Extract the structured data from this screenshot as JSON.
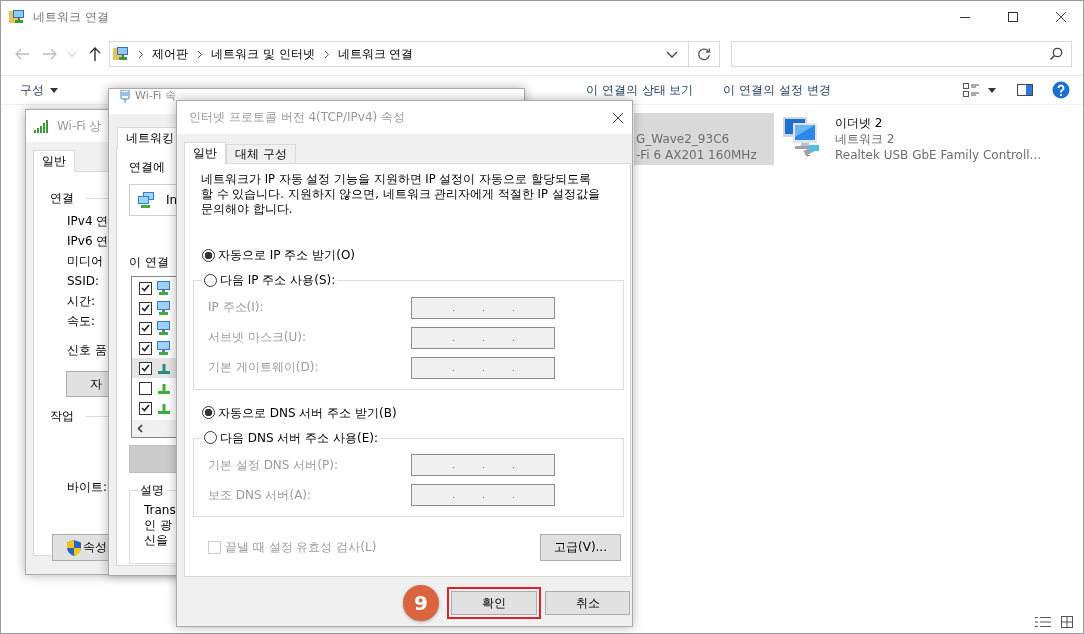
{
  "window": {
    "title": "네트워크 연결"
  },
  "address_bar": {
    "breadcrumbs": [
      "제어판",
      "네트워크 및 인터넷",
      "네트워크 연결"
    ]
  },
  "toolbar": {
    "items": [
      {
        "kind": "menu",
        "label": "구성"
      },
      {
        "kind": "command",
        "label": "이 연결의 상태 보기"
      },
      {
        "kind": "command",
        "label": "이 연결의 설정 변경"
      }
    ]
  },
  "connections": [
    {
      "kind": "wifi",
      "selected": true,
      "lines": [
        "G_Wave2_93C6",
        "-Fi 6 AX201 160MHz"
      ]
    },
    {
      "kind": "ethernet",
      "selected": false,
      "name": "이더넷 2",
      "lines": [
        "네트워크 2",
        "Realtek USB GbE Family Controll..."
      ]
    }
  ],
  "status_dialog": {
    "title": "Wi-Fi 상",
    "tabs": [
      {
        "label": "일반",
        "selected": true
      }
    ],
    "connection_heading": "연결",
    "fields": [
      "IPv4 연",
      "IPv6 연",
      "미디어",
      "SSID:",
      "시간:",
      "속도:"
    ],
    "signal_label": "신호 품",
    "details_button": "자",
    "activity_heading": "작업",
    "bytes_label": "바이트:",
    "properties_button": "속성"
  },
  "properties_dialog": {
    "title": "Wi-Fi 속",
    "tabs": [
      {
        "label": "네트워킹",
        "selected": true
      }
    ],
    "connect_label": "연결에",
    "adapter": "In",
    "items_label": "이 연결",
    "items": [
      {
        "kind": "client",
        "checked": true,
        "selected": false
      },
      {
        "kind": "client",
        "checked": true,
        "selected": false
      },
      {
        "kind": "client",
        "checked": true,
        "selected": false
      },
      {
        "kind": "client",
        "checked": true,
        "selected": false
      },
      {
        "kind": "protocol",
        "checked": true,
        "selected": true
      },
      {
        "kind": "protocol",
        "checked": false,
        "selected": false
      },
      {
        "kind": "protocol",
        "checked": true,
        "selected": false
      }
    ],
    "action_button": {
      "disabled": true
    },
    "description_heading": "설명",
    "description": [
      "Trans",
      "인 광",
      "신을"
    ]
  },
  "ipv4_dialog": {
    "title": "인터넷 프로토콜 버전 4(TCP/IPv4) 속성",
    "tabs": [
      {
        "label": "일반",
        "selected": true
      },
      {
        "label": "대체 구성",
        "selected": false
      }
    ],
    "intro": "네트워크가 IP 자동 설정 기능을 지원하면 IP 설정이 자동으로 할당되도록 할 수 있습니다. 지원하지 않으면, 네트워크 관리자에게 적절한 IP 설정값을 문의해야 합니다.",
    "ip": {
      "auto": {
        "label": "자동으로 IP 주소 받기(O)",
        "selected": true
      },
      "manual": {
        "label": "다음 IP 주소 사용(S):",
        "selected": false
      },
      "fields": [
        {
          "label": "IP 주소(I):",
          "disabled": true
        },
        {
          "label": "서브넷 마스크(U):",
          "disabled": true
        },
        {
          "label": "기본 게이트웨이(D):",
          "disabled": true
        }
      ]
    },
    "dns": {
      "auto": {
        "label": "자동으로 DNS 서버 주소 받기(B)",
        "selected": true
      },
      "manual": {
        "label": "다음 DNS 서버 주소 사용(E):",
        "selected": false
      },
      "fields": [
        {
          "label": "기본 설정 DNS 서버(P):",
          "disabled": true
        },
        {
          "label": "보조 DNS 서버(A):",
          "disabled": true
        }
      ]
    },
    "validate": {
      "label": "끝낼 때 설정 유효성 검사(L)",
      "checked": false,
      "disabled": true
    },
    "advanced_button": "고급(V)...",
    "ok_button": {
      "label": "확인",
      "highlighted": true
    },
    "cancel_button": "취소",
    "step_badge": "9"
  }
}
